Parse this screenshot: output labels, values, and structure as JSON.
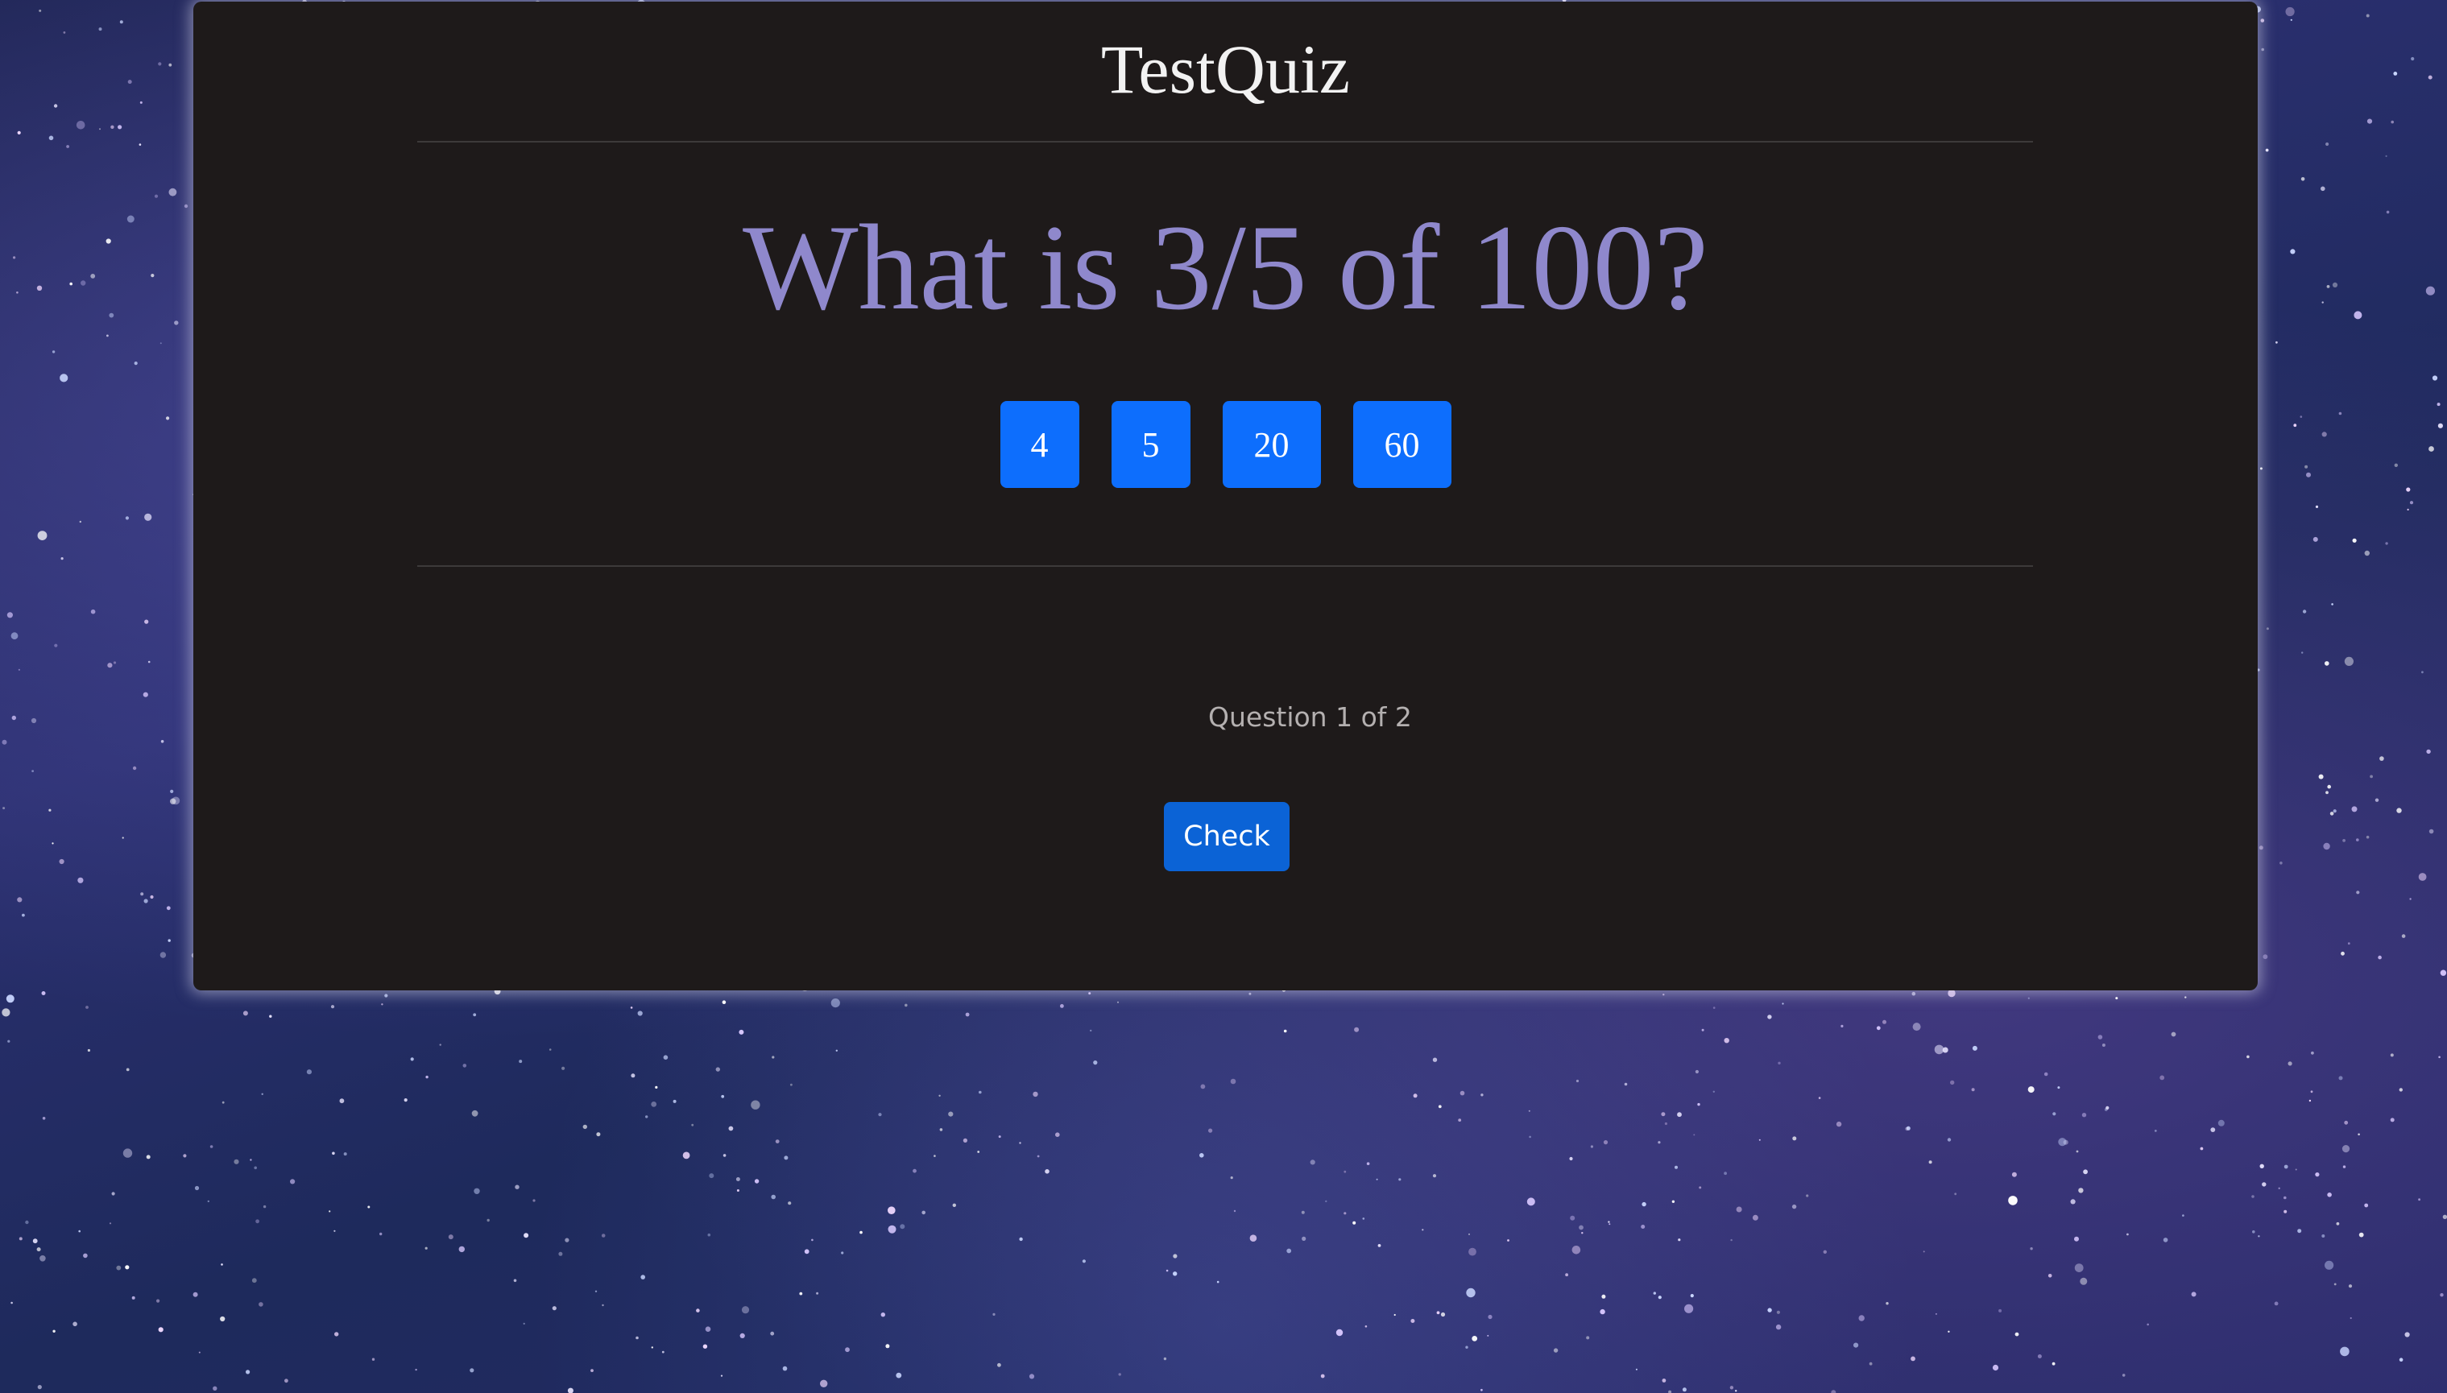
{
  "app": {
    "title": "TestQuiz"
  },
  "quiz": {
    "question": "What is 3/5 of 100?",
    "answers": [
      {
        "label": "4"
      },
      {
        "label": "5"
      },
      {
        "label": "20"
      },
      {
        "label": "60"
      }
    ],
    "progress_text": "Question 1 of 2",
    "check_label": "Check"
  },
  "theme": {
    "card_background": "#1e1a1a",
    "question_color": "#8f88cc",
    "button_color": "#0d6efd",
    "background": "starry-night-sky"
  }
}
